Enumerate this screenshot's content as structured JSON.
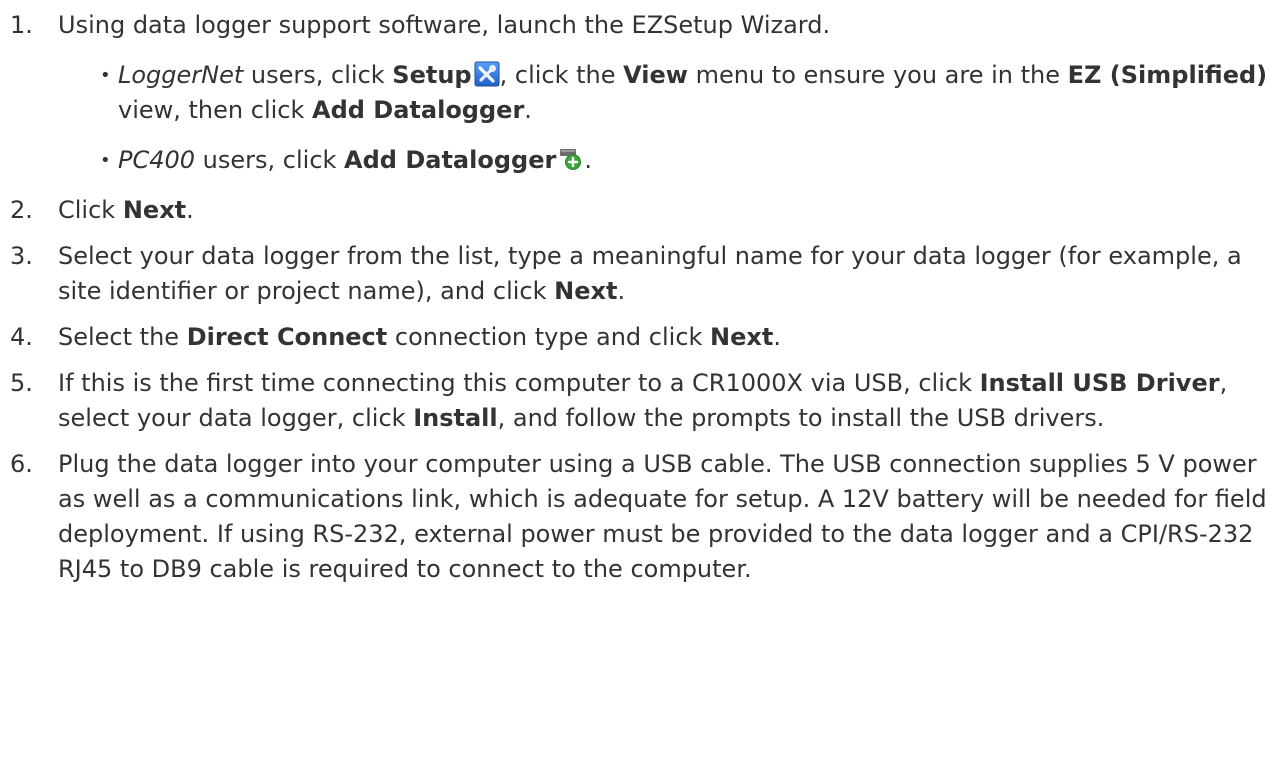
{
  "steps": [
    {
      "number": "1.",
      "parts": [
        {
          "text": "Using data logger support software, launch the EZSetup Wizard."
        }
      ],
      "subitems": [
        {
          "parts": [
            {
              "text": "LoggerNet",
              "style": "italic"
            },
            {
              "text": " users, click "
            },
            {
              "text": "Setup",
              "style": "bold"
            },
            {
              "icon": "setup-tools-icon"
            },
            {
              "text": ", click the "
            },
            {
              "text": "View",
              "style": "bold"
            },
            {
              "text": " menu to ensure you are in the "
            },
            {
              "text": "EZ (Simplified)",
              "style": "bold"
            },
            {
              "text": " view, then click "
            },
            {
              "text": "Add Datalogger",
              "style": "bold"
            },
            {
              "text": "."
            }
          ]
        },
        {
          "parts": [
            {
              "text": "PC400",
              "style": "italic"
            },
            {
              "text": " users, click "
            },
            {
              "text": "Add Datalogger",
              "style": "bold"
            },
            {
              "icon": "add-datalogger-icon"
            },
            {
              "text": "."
            }
          ]
        }
      ]
    },
    {
      "number": "2.",
      "parts": [
        {
          "text": "Click "
        },
        {
          "text": "Next",
          "style": "bold"
        },
        {
          "text": "."
        }
      ]
    },
    {
      "number": "3.",
      "parts": [
        {
          "text": "Select your data logger from the list, type a meaningful name for your data logger (for example, a site identifier or project name), and click "
        },
        {
          "text": "Next",
          "style": "bold"
        },
        {
          "text": "."
        }
      ]
    },
    {
      "number": "4.",
      "parts": [
        {
          "text": "Select the "
        },
        {
          "text": "Direct Connect",
          "style": "bold"
        },
        {
          "text": " connection type and click "
        },
        {
          "text": "Next",
          "style": "bold"
        },
        {
          "text": "."
        }
      ]
    },
    {
      "number": "5.",
      "parts": [
        {
          "text": "If this is the first time connecting this computer to a CR1000X via USB, click "
        },
        {
          "text": "Install USB Driver",
          "style": "bold"
        },
        {
          "text": ", select your data logger, click "
        },
        {
          "text": "Install",
          "style": "bold"
        },
        {
          "text": ", and follow the prompts to install the USB drivers."
        }
      ]
    },
    {
      "number": "6.",
      "parts": [
        {
          "text": "Plug the data logger into your computer using a USB  cable. The USB connection supplies 5 V power as well as a communications link, which is adequate for setup. A 12V battery will be needed for field deployment. If using RS-232, external power must be provided to the data logger and a CPI/RS-232 RJ45 to DB9 cable is required to connect to the computer."
        }
      ]
    }
  ],
  "bullet_char": "•",
  "colors": {
    "text": "#333333",
    "setup_icon_bg": "#2a6fd6",
    "add_icon_green": "#3aa63a"
  }
}
